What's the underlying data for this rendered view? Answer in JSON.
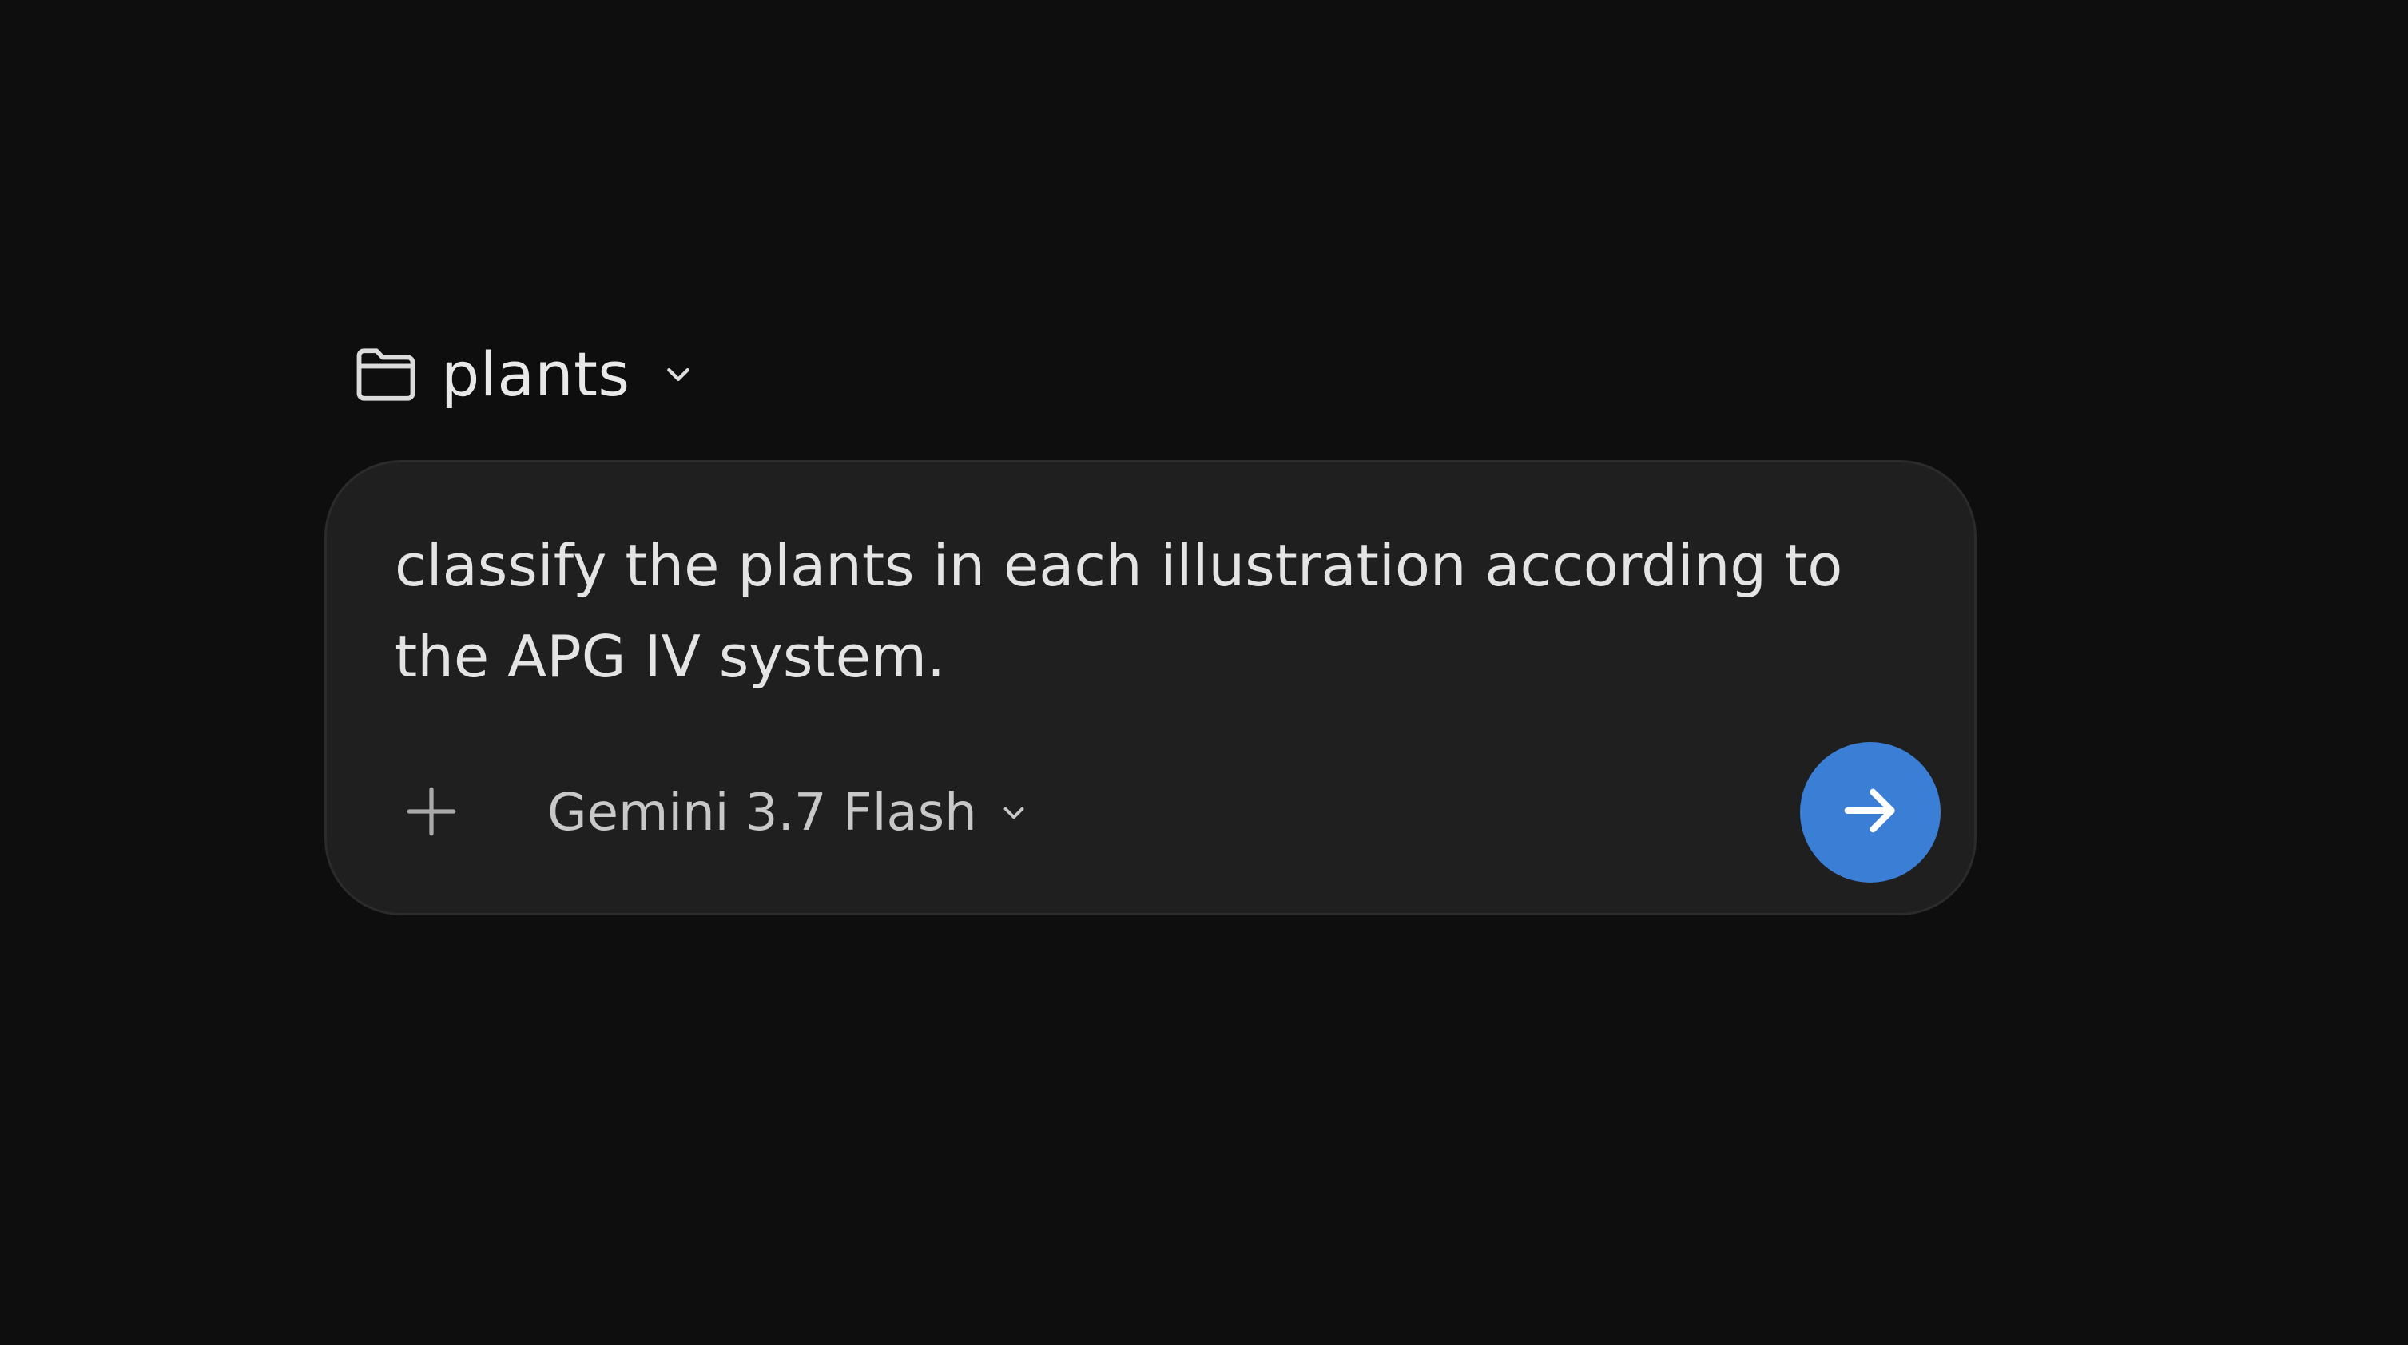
{
  "project": {
    "name": "plants",
    "folder_icon": "folder-icon",
    "chevron_icon": "chevron-down-icon"
  },
  "composer": {
    "prompt": "classify the plants in each illustration according to the APG IV system.",
    "add_icon": "plus-icon",
    "model": {
      "label": "Gemini 3.7 Flash",
      "chevron_icon": "chevron-down-icon"
    },
    "send": {
      "icon": "arrow-right-icon",
      "color": "#3a7fd5"
    }
  },
  "colors": {
    "background": "#0e0e0f",
    "composer_background": "#1f1f20",
    "accent": "#3a7fd5"
  }
}
